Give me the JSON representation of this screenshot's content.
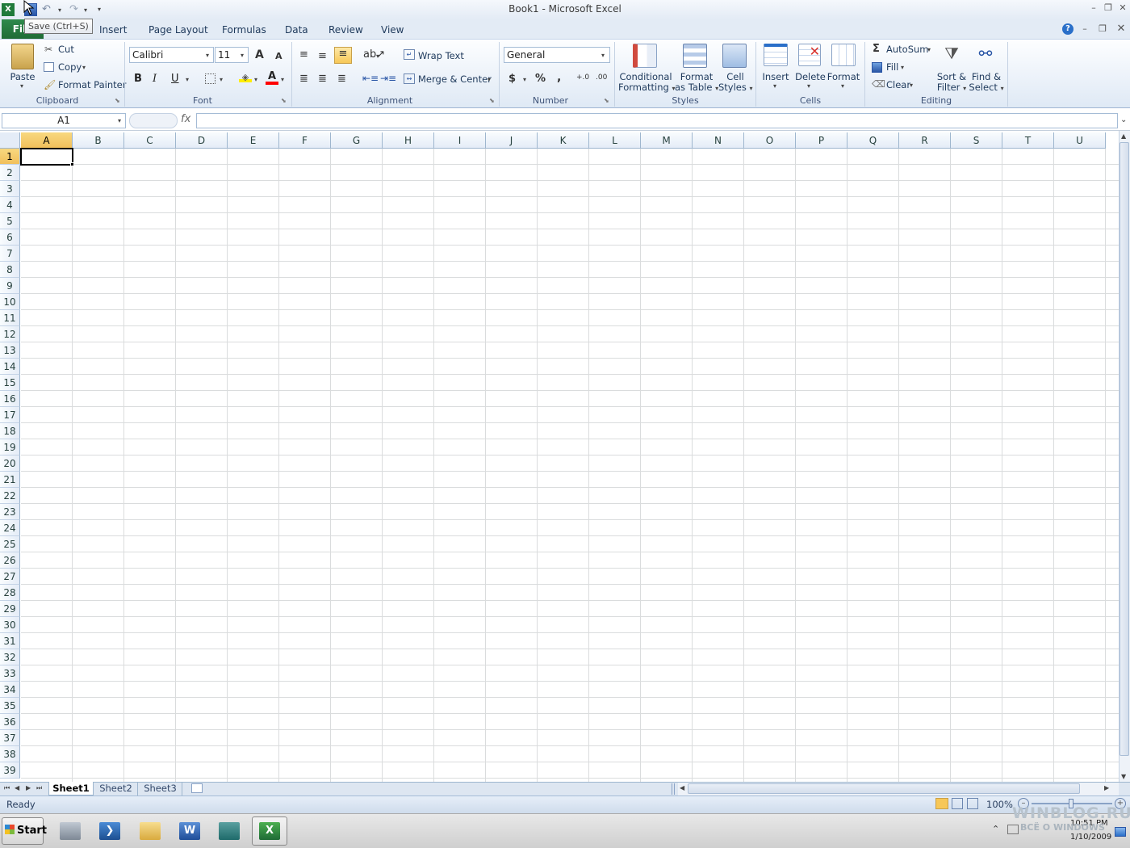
{
  "window": {
    "title": "Book1  -  Microsoft Excel"
  },
  "qat": {
    "save_tooltip": "Save (Ctrl+S)"
  },
  "tabs": {
    "file": "File",
    "home": "Home",
    "insert": "Insert",
    "page_layout": "Page Layout",
    "formulas": "Formulas",
    "data": "Data",
    "review": "Review",
    "view": "View"
  },
  "clipboard": {
    "label": "Clipboard",
    "paste": "Paste",
    "cut": "Cut",
    "copy": "Copy",
    "format_painter": "Format Painter"
  },
  "font": {
    "label": "Font",
    "name": "Calibri",
    "size": "11",
    "bold": "B",
    "italic": "I",
    "underline": "U",
    "grow": "A",
    "shrink": "A",
    "font_color_glyph": "A"
  },
  "alignment": {
    "label": "Alignment",
    "wrap_text": "Wrap Text",
    "merge_center": "Merge & Center"
  },
  "number": {
    "label": "Number",
    "format": "General",
    "currency": "$",
    "percent": "%",
    "comma": ",",
    "inc_dec": "+.0",
    "dec_dec": ".00"
  },
  "styles": {
    "label": "Styles",
    "conditional_1": "Conditional",
    "conditional_2": "Formatting",
    "format_table_1": "Format",
    "format_table_2": "as Table",
    "cell_styles_1": "Cell",
    "cell_styles_2": "Styles"
  },
  "cells": {
    "label": "Cells",
    "insert": "Insert",
    "delete": "Delete",
    "format": "Format"
  },
  "editing": {
    "label": "Editing",
    "autosum": "AutoSum",
    "fill": "Fill",
    "clear": "Clear",
    "sort_1": "Sort &",
    "sort_2": "Filter",
    "find_1": "Find &",
    "find_2": "Select"
  },
  "formula_bar": {
    "name_box": "A1",
    "fx": "fx",
    "value": ""
  },
  "grid": {
    "columns": [
      "A",
      "B",
      "C",
      "D",
      "E",
      "F",
      "G",
      "H",
      "I",
      "J",
      "K",
      "L",
      "M",
      "N",
      "O",
      "P",
      "Q",
      "R",
      "S",
      "T",
      "U"
    ],
    "rows": [
      "1",
      "2",
      "3",
      "4",
      "5",
      "6",
      "7",
      "8",
      "9",
      "10",
      "11",
      "12",
      "13",
      "14",
      "15",
      "16",
      "17",
      "18",
      "19",
      "20",
      "21",
      "22",
      "23",
      "24",
      "25",
      "26",
      "27",
      "28",
      "29",
      "30",
      "31",
      "32",
      "33",
      "34",
      "35",
      "36",
      "37",
      "38",
      "39"
    ],
    "selected_cell": "A1"
  },
  "sheets": [
    "Sheet1",
    "Sheet2",
    "Sheet3"
  ],
  "active_sheet": "Sheet1",
  "status": {
    "ready": "Ready",
    "zoom": "100%"
  },
  "taskbar": {
    "start": "Start",
    "time": "10:51 PM",
    "date": "1/10/2009"
  },
  "watermark": {
    "line1": "WINBLOG.RU",
    "line2": "ВСЁ О WINDOWS"
  },
  "colors": {
    "accent": "#1e395b",
    "file_tab": "#1f6b36",
    "selection_header": "#f1c05b",
    "ribbon_bg": "#dfe9f5"
  }
}
